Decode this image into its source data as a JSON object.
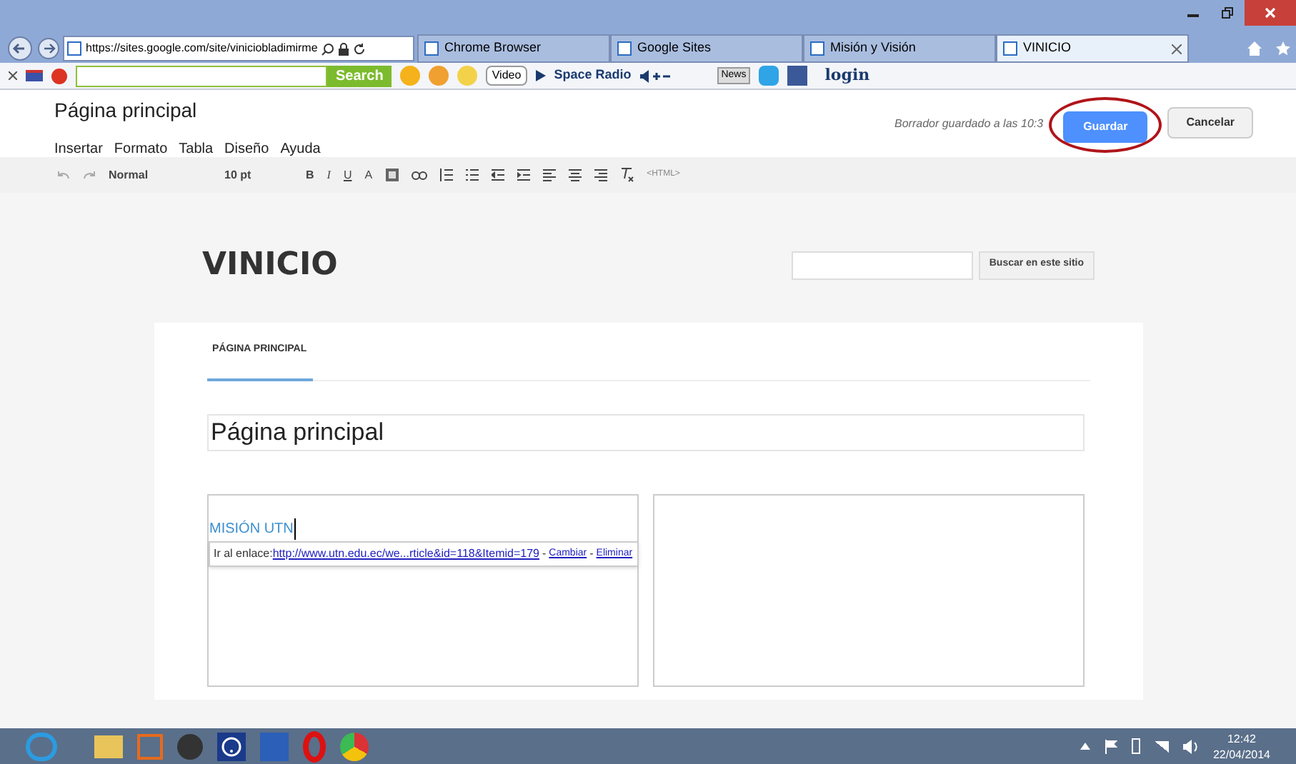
{
  "browser": {
    "address": "https://sites.google.com/site/viniciobladimirme",
    "tabs": [
      {
        "label": "Chrome Browser",
        "selected": false
      },
      {
        "label": "Google Sites",
        "selected": false
      },
      {
        "label": "Misión y Visión",
        "selected": false
      },
      {
        "label": "VINICIO",
        "selected": true
      }
    ],
    "toolbar": {
      "search_button": "Search",
      "video": "Video",
      "radio": "Space Radio",
      "news": "News",
      "login": "login"
    }
  },
  "editor": {
    "page_title": "Página principal",
    "menu": [
      "Insertar",
      "Formato",
      "Tabla",
      "Diseño",
      "Ayuda"
    ],
    "draft_status": "Borrador guardado a las 10:3",
    "save_button": "Guardar",
    "cancel_button": "Cancelar",
    "format_toolbar": {
      "style": "Normal",
      "size": "10 pt",
      "bold": "B",
      "italic": "I",
      "underline": "U",
      "font_color": "A",
      "html": "<HTML>"
    }
  },
  "site": {
    "title": "VINICIO",
    "search_button": "Buscar en este sitio",
    "nav": [
      {
        "label": "PÁGINA PRINCIPAL",
        "selected": true
      }
    ],
    "page_title": "Página principal",
    "column_1": {
      "heading": "MISIÓN UTN",
      "link_bubble": {
        "prefix": "Ir al enlace:",
        "url": "http://www.utn.edu.ec/we...rticle&id=118&Itemid=179",
        "separator_1": "-",
        "change": "Cambiar",
        "separator_2": "-",
        "remove": "Eliminar"
      }
    }
  },
  "taskbar": {
    "time": "12:42",
    "date": "22/04/2014"
  }
}
